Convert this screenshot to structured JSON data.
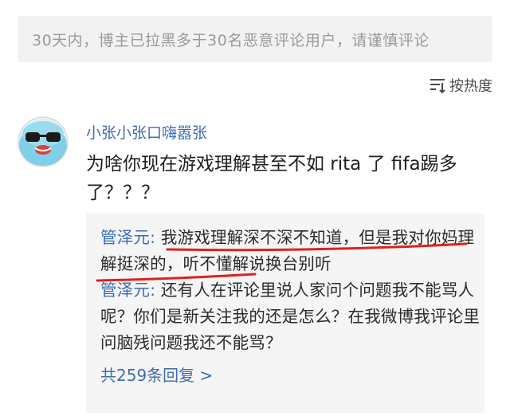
{
  "notice": {
    "text": "30天内，博主已拉黑多于30名恶意评论用户，请谨慎评论"
  },
  "sort": {
    "label": "按热度"
  },
  "comment": {
    "username": "小张小张口嗨嚣张",
    "text": "为啥你现在游戏理解甚至不如 rita 了 fifa踢多了？？？"
  },
  "replies": [
    {
      "author": "管泽元:",
      "text": " 我游戏理解深不深不知道，但是我对你妈理解挺深的，听不懂解说换台别听"
    },
    {
      "author": "管泽元:",
      "text": " 还有人在评论里说人家问个问题我不能骂人呢？你们是新关注我的还是怎么？在我微博我评论里问脑残问题我还不能骂？"
    }
  ],
  "more_replies": {
    "label": "共259条回复 >"
  },
  "colors": {
    "link": "#3d6db0",
    "underline": "#e02020",
    "notice_bg": "#f2f2f2",
    "reply_bg": "#f5f5f5"
  },
  "icons": {
    "sort": "sort-icon",
    "avatar": "avatar-sunglasses"
  }
}
